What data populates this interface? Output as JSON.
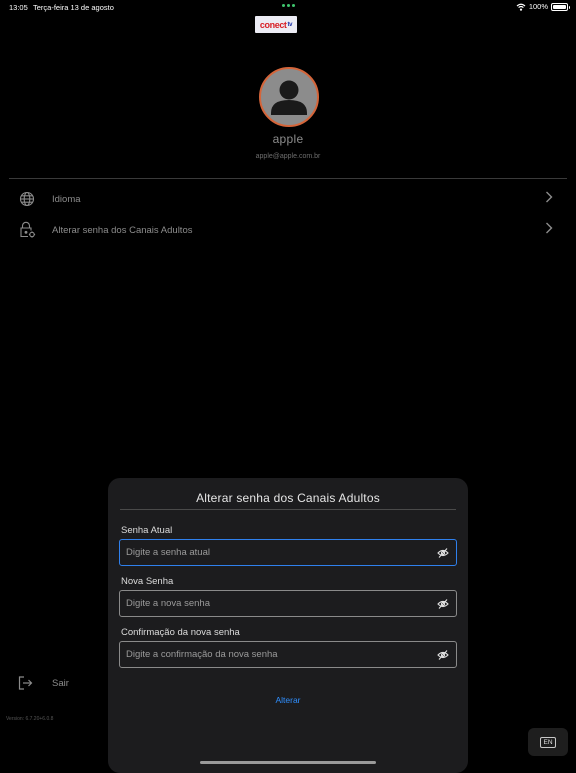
{
  "status_bar": {
    "time": "13:05",
    "date": "Terça-feira 13 de agosto",
    "battery": "100%",
    "battery_level": 1.0
  },
  "logo": {
    "part1": "conect",
    "part2": "tv"
  },
  "profile": {
    "name": "apple",
    "email": "apple@apple.com.br"
  },
  "menu": [
    {
      "label": "Idioma",
      "icon": "globe-icon"
    },
    {
      "label": "Alterar senha dos Canais Adultos",
      "icon": "lock-settings-icon"
    }
  ],
  "logout": {
    "label": "Sair",
    "icon": "logout-icon"
  },
  "version": "Version: 6.7.20+6.0.8",
  "modal": {
    "title": "Alterar senha dos Canais Adultos",
    "fields": [
      {
        "label": "Senha Atual",
        "placeholder": "Digite a senha atual",
        "value": ""
      },
      {
        "label": "Nova Senha",
        "placeholder": "Digite a nova senha",
        "value": ""
      },
      {
        "label": "Confirmação da nova senha",
        "placeholder": "Digite a confirmação da nova senha",
        "value": ""
      }
    ],
    "submit_label": "Alterar"
  },
  "language_button": "EN",
  "colors": {
    "accent": "#2f80ed",
    "link": "#2f8fff",
    "avatar_ring": "#d4653a",
    "status_dots": "#3ec46d"
  }
}
